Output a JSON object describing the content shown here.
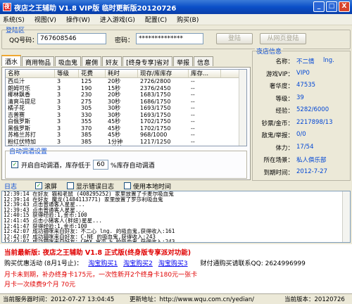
{
  "window": {
    "title": "夜店之王辅助 V1.8 VIP版 临时更新版20120726",
    "min": "_",
    "max": "□",
    "close": "X"
  },
  "menu": [
    "系统(S)",
    "视图(V)",
    "操作(W)",
    "进入游戏(G)",
    "配置(C)",
    "购买(B)"
  ],
  "login": {
    "group_title": "登陆区",
    "qq_label": "QQ号码：",
    "qq_value": "767608546",
    "pw_label": "密码：",
    "pw_value": "**************",
    "login_btn": "登陆",
    "sync_btn": "从网页登陆"
  },
  "tabs": [
    "酒水",
    "商用物品",
    "吸血鬼",
    "雇佣",
    "奸友",
    "[终身专享]省对",
    "举报",
    "信息"
  ],
  "table": {
    "columns": [
      "名称",
      "等级",
      "花费",
      "耗时",
      "现存/库库存",
      "库存..."
    ],
    "rows": [
      [
        "西瓜汁",
        "3",
        "125",
        "20秒",
        "2726/2800",
        "--"
      ],
      [
        "朗姆可乐",
        "3",
        "190",
        "15秒",
        "2376/2450",
        "--"
      ],
      [
        "椰林飘香",
        "3",
        "230",
        "20秒",
        "1683/1750",
        "--"
      ],
      [
        "清爽马提尼",
        "3",
        "275",
        "30秒",
        "1686/1750",
        "--"
      ],
      [
        "橘子花",
        "3",
        "305",
        "30秒",
        "1693/1750",
        "--"
      ],
      [
        "吉普赛",
        "3",
        "330",
        "30秒",
        "1693/1750",
        "--"
      ],
      [
        "白俄罗斯",
        "3",
        "355",
        "45秒",
        "1702/1750",
        "--"
      ],
      [
        "黑俄罗斯",
        "3",
        "370",
        "45秒",
        "1702/1750",
        "--"
      ],
      [
        "苏格兰苏打",
        "3",
        "385",
        "45秒",
        "968/1000",
        "--"
      ],
      [
        "粉红伏特加",
        "3",
        "385",
        "1分钟",
        "1217/1250",
        "--"
      ],
      [
        "玛格丽特",
        "3",
        "400",
        "1分钟",
        "1202/1250",
        "--"
      ]
    ]
  },
  "autoset": {
    "title": "自动调酒设置",
    "checkbox_label": "开启自动调酒，库存低于",
    "threshold": "60",
    "suffix": "%库存自动调酒"
  },
  "info": {
    "title": "夜店信息",
    "rows": [
      {
        "k": "名称：",
        "v": "不二情",
        "extra": "lng."
      },
      {
        "k": "游戏VIP：",
        "v": "VIP0"
      },
      {
        "k": "奢华度：",
        "v": "47535"
      },
      {
        "k": "等级：",
        "v": "39"
      },
      {
        "k": "经验：",
        "v": "5282/6000"
      },
      {
        "k": "钞票/金币：",
        "v": "2217898/13"
      },
      {
        "k": "敌鬼/举报：",
        "v": "0/0"
      },
      {
        "k": "体力：",
        "v": "17/54"
      },
      {
        "k": "所在场景：",
        "v": "私人俱乐部"
      },
      {
        "k": "到期时间：",
        "v": "2012-7-27"
      }
    ]
  },
  "logbar": {
    "label": "日志",
    "opt1": "滚屏",
    "opt2": "显示错误日志",
    "opt3": "使用本地时间"
  },
  "log": [
    "12:39:14 在好友 猫和老鼠 (408295252) 家里放置了卡麦尔吸血鬼",
    "12:39:14 在好友 魔龙(1484113771) 家里放置了罗莎利吸血鬼",
    "12:39:43 点击普通客人星星...",
    "12:39:43 点击普通客人星星...",
    "12:40:15 获得经验:1,金币:100",
    "12:41:45 点击小猪客人(胖妞)星星...",
    "12:41:47 获得经验:1,金币:100",
    "12:42:07 成功猫咪来自好友：不二心    lng.    的吸血鬼,获得收入:161",
    "12:42:07 成功猫咪来自好友：C-NE 的吸血鬼,获得收入:243",
    "12:42:07 成功猫咪来自好友：C破X 贪恋 % 的吸血鬼,获得收入:243"
  ],
  "promo": {
    "line1": "当前最新版: 夜店之王辅助 V1.8 正式版(终身版专享派对功能)",
    "buy_label": "购买优惠活动 (8月1号止)：",
    "shop1": "淘宝购买1",
    "shop2": "淘宝购买2",
    "shop3": "淘宝购买3",
    "qq_label": "财付通购买请联系QQ: 2624996999",
    "line3": "月卡未到期，补办终身卡175元，一次性新开2个终身卡180元一张卡",
    "line4": "月卡一次续费9个月 70元"
  },
  "status": {
    "server_time": "当前服务器时间：2012-07-27 13:04:45",
    "update_addr": "更新地址：http://www.wqu.com.cn/yedian/",
    "version": "当前版本：20120726"
  },
  "colors": {
    "accent": "#0046d5",
    "promo_red": "#e00000",
    "link": "#0000ee"
  }
}
